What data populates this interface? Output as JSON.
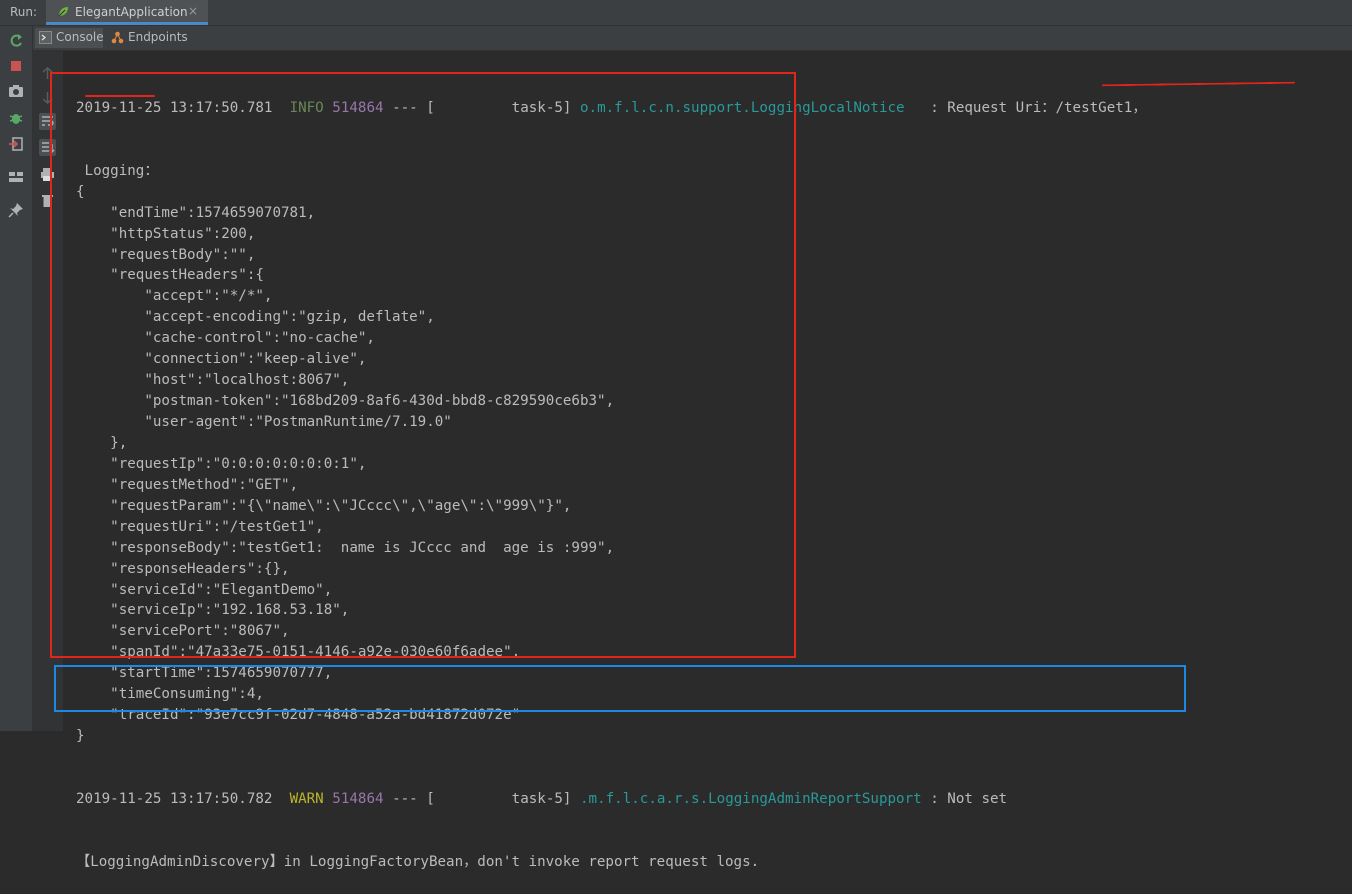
{
  "run_bar": {
    "label": "Run:",
    "tab_label": "ElegantApplication",
    "close_glyph": "×"
  },
  "sub_tabs": [
    {
      "label": "Console",
      "icon": "console-icon"
    },
    {
      "label": "Endpoints",
      "icon": "endpoints-icon"
    }
  ],
  "log_header": {
    "date": "2019-11-25 13:17:50.781",
    "level": "INFO",
    "pid": "514864",
    "thread": "--- [         task-5]",
    "logger": "o.m.f.l.c.n.support.LoggingLocalNotice",
    "message": "   : Request Uri：/testGet1，"
  },
  "log_lines": [
    " Logging：",
    "{",
    "    \"endTime\":1574659070781,",
    "    \"httpStatus\":200,",
    "    \"requestBody\":\"\",",
    "    \"requestHeaders\":{",
    "        \"accept\":\"*/*\",",
    "        \"accept-encoding\":\"gzip, deflate\",",
    "        \"cache-control\":\"no-cache\",",
    "        \"connection\":\"keep-alive\",",
    "        \"host\":\"localhost:8067\",",
    "        \"postman-token\":\"168bd209-8af6-430d-bbd8-c829590ce6b3\",",
    "        \"user-agent\":\"PostmanRuntime/7.19.0\"",
    "    },",
    "    \"requestIp\":\"0:0:0:0:0:0:0:1\",",
    "    \"requestMethod\":\"GET\",",
    "    \"requestParam\":\"{\\\"name\\\":\\\"JCccc\\\",\\\"age\\\":\\\"999\\\"}\",",
    "    \"requestUri\":\"/testGet1\",",
    "    \"responseBody\":\"testGet1:  name is JCccc and  age is :999\",",
    "    \"responseHeaders\":{},",
    "    \"serviceId\":\"ElegantDemo\",",
    "    \"serviceIp\":\"192.168.53.18\",",
    "    \"servicePort\":\"8067\",",
    "    \"spanId\":\"47a33e75-0151-4146-a92e-030e60f6adee\",",
    "    \"startTime\":1574659070777,",
    "    \"timeConsuming\":4,",
    "    \"traceId\":\"93e7cc9f-02d7-4848-a52a-bd41872d072e\"",
    "}"
  ],
  "warn_header": {
    "date": "2019-11-25 13:17:50.782",
    "level": "WARN",
    "pid": "514864",
    "thread": "--- [         task-5]",
    "logger": ".m.f.l.c.a.r.s.LoggingAdminReportSupport",
    "message": " : Not set"
  },
  "warn_line2": "【LoggingAdminDiscovery】in LoggingFactoryBean，don't invoke report request logs.",
  "colors": {
    "background": "#2b2b2b",
    "info": "#6a8759",
    "warn": "#bbb529",
    "pid": "#9876aa",
    "logger": "#299999",
    "annotation_red": "#e1251b",
    "annotation_blue": "#1e88e5"
  },
  "toolbar_icons": [
    "rerun-icon",
    "stop-icon",
    "camera-icon",
    "debug-icon",
    "exit-icon",
    "layout-icon",
    "pin-icon"
  ],
  "gutter_icons": [
    "up-arrow-icon",
    "down-arrow-icon",
    "soft-wrap-icon",
    "scroll-to-end-icon",
    "print-icon",
    "trash-icon"
  ]
}
